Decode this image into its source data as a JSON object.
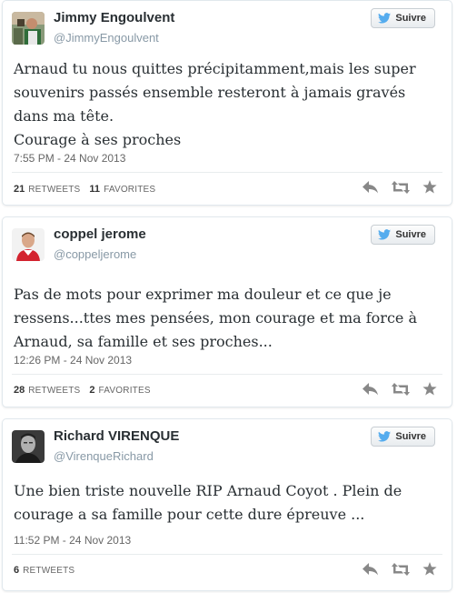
{
  "follow_label": "Suivre",
  "tweets": [
    {
      "name": "Jimmy Engoulvent",
      "handle": "@JimmyEngoulvent",
      "text": "Arnaud tu nous quittes précipitamment,mais les super souvenirs passés ensemble resteront à jamais gravés dans ma tête.\nCourage à ses proches",
      "time": "7:55 PM - 24 Nov 2013",
      "retweets": "21",
      "retweets_label": "RETWEETS",
      "favorites": "11",
      "favorites_label": "FAVORITES"
    },
    {
      "name": "coppel jerome",
      "handle": "@coppeljerome",
      "text": "Pas de mots pour exprimer ma douleur et ce que je ressens...ttes mes pensées, mon courage et ma force à Arnaud, sa famille et ses proches...",
      "time": "12:26 PM - 24 Nov 2013",
      "retweets": "28",
      "retweets_label": "RETWEETS",
      "favorites": "2",
      "favorites_label": "FAVORITES"
    },
    {
      "name": "Richard VIRENQUE",
      "handle": "@VirenqueRichard",
      "text": "Une bien triste nouvelle RIP Arnaud Coyot . Plein de courage a  sa famille pour cette dure épreuve ...",
      "time": "11:52 PM - 24 Nov 2013",
      "retweets": "6",
      "retweets_label": "RETWEETS"
    }
  ],
  "icons": [
    "twitter-bird-icon",
    "reply-icon",
    "retweet-icon",
    "favorite-star-icon"
  ],
  "colors": {
    "twitter_blue": "#55acee",
    "action_grey": "#888888"
  }
}
